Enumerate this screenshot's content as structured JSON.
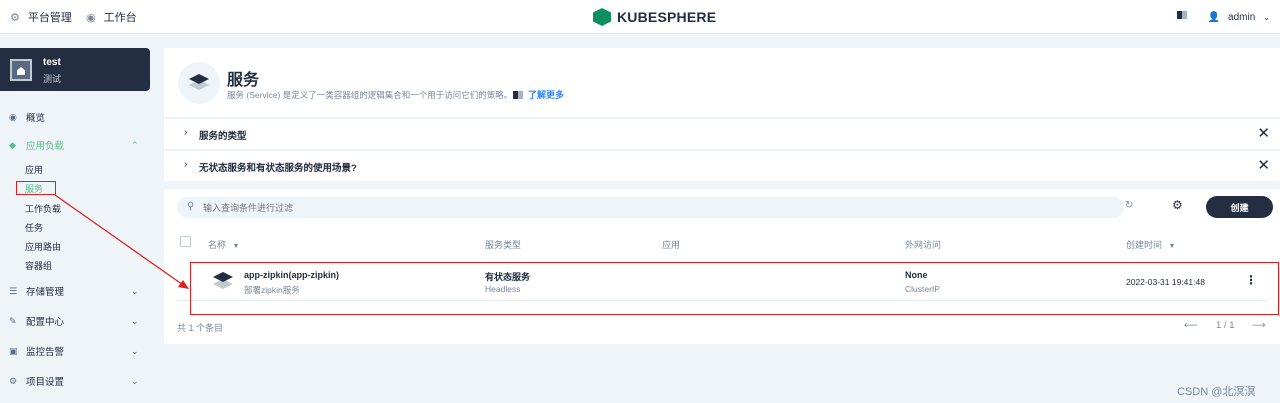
{
  "topbar": {
    "platform_label": "平台管理",
    "workbench_label": "工作台",
    "logo_text": "KUBESPHERE",
    "user_name": "admin"
  },
  "workspace": {
    "name": "test",
    "desc": "测试"
  },
  "sidebar": {
    "items": [
      {
        "label": "概览",
        "icon": "overview-icon"
      },
      {
        "label": "应用负载",
        "icon": "app-workload-icon"
      },
      {
        "label": "存储管理",
        "icon": "storage-icon"
      },
      {
        "label": "配置中心",
        "icon": "config-icon"
      },
      {
        "label": "监控告警",
        "icon": "monitor-icon"
      },
      {
        "label": "项目设置",
        "icon": "project-settings-icon"
      }
    ],
    "sub_items": [
      "应用",
      "服务",
      "工作负载",
      "任务",
      "应用路由",
      "容器组"
    ]
  },
  "banner": {
    "title": "服务",
    "desc": "服务 (Service) 是定义了一类容器组的逻辑集合和一个用于访问它们的策略。",
    "learn_more": "了解更多"
  },
  "collapsibles": [
    "服务的类型",
    "无状态服务和有状态服务的使用场景?"
  ],
  "table": {
    "search_placeholder": "输入查询条件进行过滤",
    "create_label": "创建",
    "headers": {
      "name": "名称",
      "service_type": "服务类型",
      "app": "应用",
      "external_access": "外网访问",
      "created_time": "创建时间"
    },
    "rows": [
      {
        "name": "app-zipkin(app-zipkin)",
        "desc": "部署zipkin服务",
        "type": "有状态服务",
        "type_sub": "Headless",
        "app": "",
        "access": "None",
        "access_sub": "ClusterIP",
        "created": "2022-03-31 19:41:48"
      }
    ],
    "total": "共 1 个条目",
    "page": "1 / 1"
  },
  "watermark": "CSDN @北溟溟",
  "colors": {
    "accent": "#55bc8a",
    "annotation": "#e02020",
    "dark": "#242e42"
  }
}
